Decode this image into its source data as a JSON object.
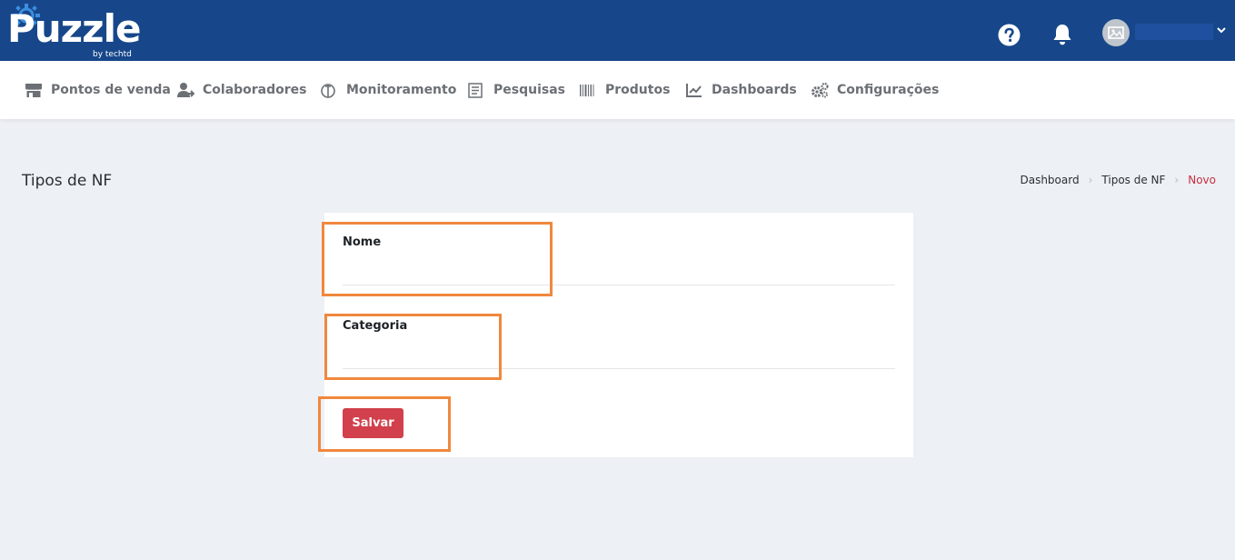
{
  "app": {
    "logo_text": "Puzzle",
    "logo_sub": "by techtd"
  },
  "topbar": {
    "help_icon": "question-circle-icon",
    "notifications_icon": "bell-icon",
    "avatar_icon": "image-placeholder-icon",
    "menu_icon": "chevron-down-icon"
  },
  "nav": {
    "items": [
      {
        "label": "Pontos de venda",
        "icon": "store-icon"
      },
      {
        "label": "Colaboradores",
        "icon": "users-icon"
      },
      {
        "label": "Monitoramento",
        "icon": "monitor-icon"
      },
      {
        "label": "Pesquisas",
        "icon": "survey-icon"
      },
      {
        "label": "Produtos",
        "icon": "barcode-icon"
      },
      {
        "label": "Dashboards",
        "icon": "chart-line-icon"
      },
      {
        "label": "Configurações",
        "icon": "gears-icon"
      }
    ]
  },
  "page": {
    "title": "Tipos de NF"
  },
  "breadcrumb": {
    "items": [
      "Dashboard",
      "Tipos de NF"
    ],
    "current": "Novo"
  },
  "form": {
    "nome_label": "Nome",
    "nome_value": "",
    "categoria_label": "Categoria",
    "categoria_value": "",
    "save_label": "Salvar"
  },
  "colors": {
    "topbar": "#17478a",
    "accent": "#d1404c",
    "highlight": "#f0883e",
    "background": "#edf0f5"
  }
}
